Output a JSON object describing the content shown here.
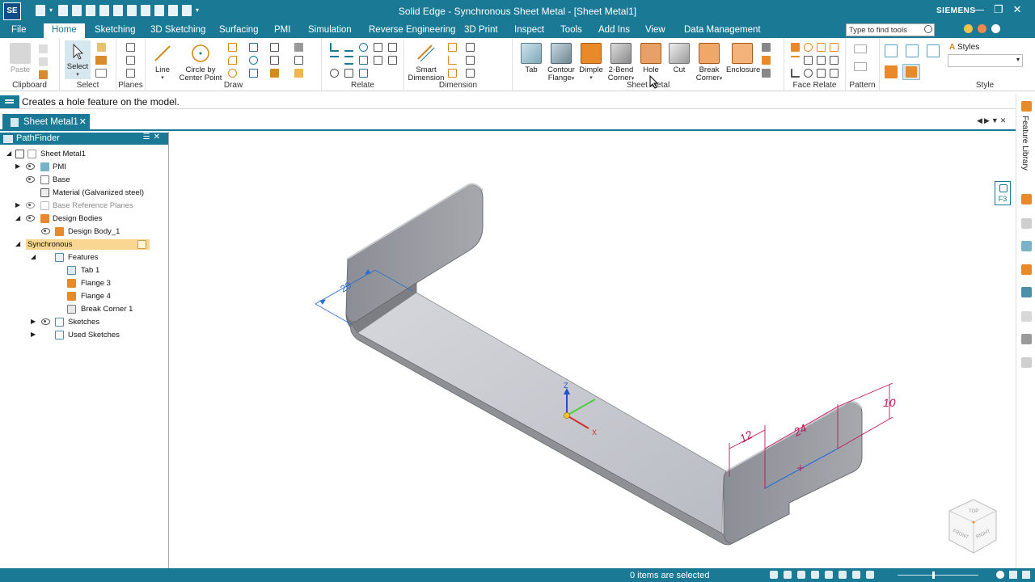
{
  "app": {
    "logo": "SE",
    "title": "Solid Edge - Synchronous Sheet Metal - [Sheet Metal1]",
    "brand": "SIEMENS",
    "window_buttons": [
      "—",
      "❐",
      "✕"
    ]
  },
  "menu": {
    "tabs": [
      "File",
      "Home",
      "Sketching",
      "3D Sketching",
      "Surfacing",
      "PMI",
      "Simulation",
      "Reverse Engineering",
      "3D Print",
      "Inspect",
      "Tools",
      "Add Ins",
      "View",
      "Data Management"
    ],
    "active": "Home",
    "search_placeholder": "Type to find tools"
  },
  "ribbon": {
    "groups": [
      "Clipboard",
      "Select",
      "Planes",
      "Draw",
      "Relate",
      "Dimension",
      "Sheet Metal",
      "Face Relate",
      "Pattern",
      "Style"
    ],
    "buttons": {
      "paste": "Paste",
      "select": "Select",
      "line": "Line",
      "circle1": "Circle by",
      "circle2": "Center Point",
      "smart1": "Smart",
      "smart2": "Dimension",
      "tab": "Tab",
      "contour1": "Contour",
      "contour2": "Flange",
      "dimple": "Dimple",
      "bend1": "2-Bend",
      "bend2": "Corner",
      "hole": "Hole",
      "cut": "Cut",
      "break1": "Break",
      "break2": "Corner",
      "enclosure": "Enclosure",
      "styles": "Styles"
    }
  },
  "prompt": "Creates a hole feature on the model.",
  "document_tab": "Sheet Metal1",
  "pathfinder": {
    "title": "PathFinder",
    "items": [
      {
        "label": "Sheet Metal1"
      },
      {
        "label": "PMI"
      },
      {
        "label": "Base"
      },
      {
        "label": "Material (Galvanized steel)"
      },
      {
        "label": "Base Reference Planes"
      },
      {
        "label": "Design Bodies"
      },
      {
        "label": "Design Body_1"
      },
      {
        "label": "Synchronous"
      },
      {
        "label": "Features"
      },
      {
        "label": "Tab 1"
      },
      {
        "label": "Flange 3"
      },
      {
        "label": "Flange 4"
      },
      {
        "label": "Break Corner 1"
      },
      {
        "label": "Sketches"
      },
      {
        "label": "Used Sketches"
      }
    ]
  },
  "viewport": {
    "dimensions": [
      "20",
      "12",
      "24",
      "10"
    ],
    "axes": {
      "z": "Z",
      "x": "X"
    },
    "view_cube": {
      "top": "TOP",
      "front": "FRONT",
      "right": "RIGHT"
    }
  },
  "right_dock": {
    "label": "Feature Library",
    "f3": "F3"
  },
  "status": {
    "text": "0 items are selected"
  },
  "colors": {
    "accent": "#1a7a96",
    "sync_highlight": "#f9d691",
    "dimension_blue": "#2a6fd1",
    "dimension_magenta": "#c2185b"
  }
}
